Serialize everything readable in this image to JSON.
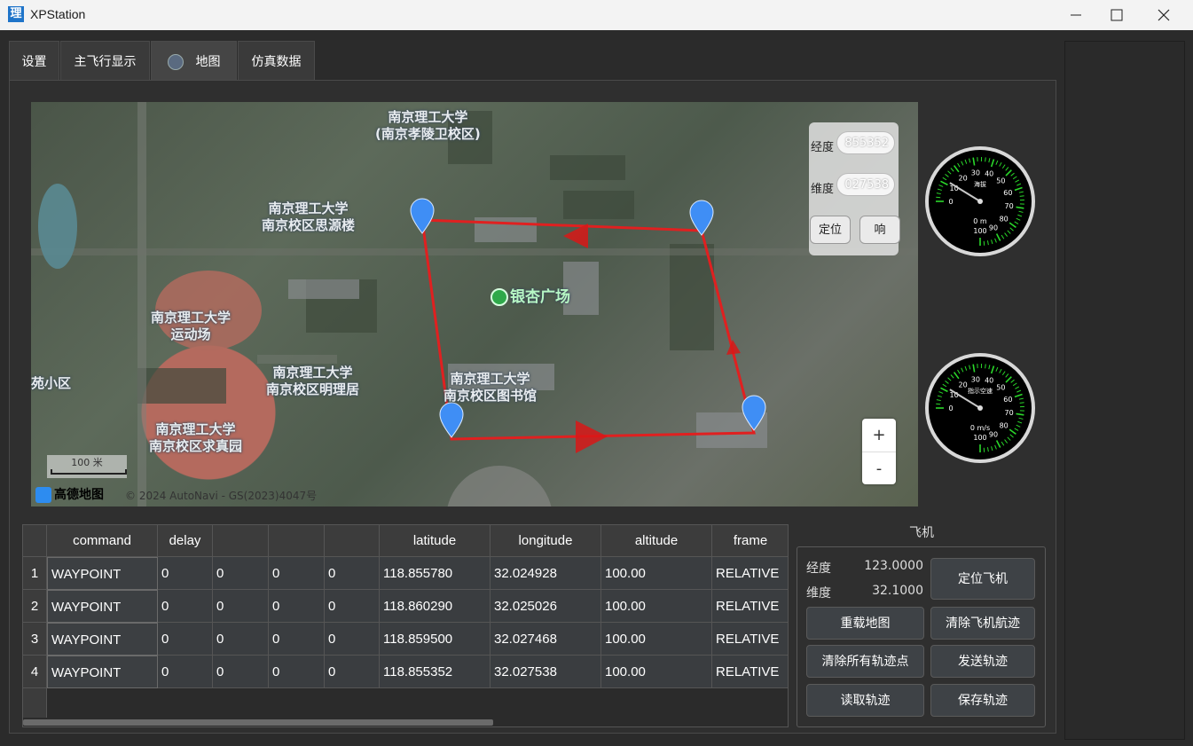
{
  "window": {
    "title": "XPStation",
    "icon_char": "理"
  },
  "tabs": [
    {
      "label": "设置"
    },
    {
      "label": "主飞行显示"
    },
    {
      "label": "地图"
    },
    {
      "label": "仿真数据"
    }
  ],
  "map": {
    "labels": [
      "南京理工大学\n(南京孝陵卫校区)",
      "南京理工大学\n南京校区思源楼",
      "南京理工大学\n运动场",
      "南京理工大学\n南京校区明理居",
      "南京理工大学\n南京校区图书馆",
      "南京理工大学\n南京校区求真园",
      "苑小区",
      "银杏广场"
    ],
    "overlay": {
      "lng_label": "经度",
      "lng_value": "855352",
      "lat_label": "维度",
      "lat_value": "027538",
      "locate_label": "定位",
      "other_label": "响"
    },
    "zoom_in": "+",
    "zoom_out": "-",
    "scale_label": "100 米",
    "logo_text": "高德地图",
    "copyright": "© 2024 AutoNavi - GS(2023)4047号"
  },
  "gauges": [
    {
      "title": "海拔",
      "unit": "0 m",
      "value": 0,
      "ticks": [
        "0",
        "10",
        "20",
        "30",
        "40",
        "50",
        "60",
        "70",
        "80",
        "90",
        "100"
      ]
    },
    {
      "title": "指示空速",
      "unit": "0 m/s",
      "value": 0,
      "ticks": [
        "0",
        "10",
        "20",
        "30",
        "40",
        "50",
        "60",
        "70",
        "80",
        "90",
        "100"
      ]
    }
  ],
  "table": {
    "headers": [
      "command",
      "delay",
      "",
      "",
      "",
      "latitude",
      "longitude",
      "altitude",
      "frame"
    ],
    "rows": [
      {
        "num": "1",
        "cells": [
          "WAYPOINT",
          "0",
          "0",
          "0",
          "0",
          "118.855780",
          "32.024928",
          "100.00",
          "RELATIVE"
        ]
      },
      {
        "num": "2",
        "cells": [
          "WAYPOINT",
          "0",
          "0",
          "0",
          "0",
          "118.860290",
          "32.025026",
          "100.00",
          "RELATIVE"
        ]
      },
      {
        "num": "3",
        "cells": [
          "WAYPOINT",
          "0",
          "0",
          "0",
          "0",
          "118.859500",
          "32.027468",
          "100.00",
          "RELATIVE"
        ]
      },
      {
        "num": "4",
        "cells": [
          "WAYPOINT",
          "0",
          "0",
          "0",
          "0",
          "118.855352",
          "32.027538",
          "100.00",
          "RELATIVE"
        ]
      }
    ]
  },
  "aircraft_panel": {
    "title": "飞机",
    "lng_label": "经度",
    "lng_value": "123.0000",
    "lat_label": "维度",
    "lat_value": "32.1000",
    "buttons": {
      "locate": "定位飞机",
      "reload_map": "重载地图",
      "clear_track": "清除飞机航迹",
      "clear_points": "清除所有轨迹点",
      "send_track": "发送轨迹",
      "read_track": "读取轨迹",
      "save_track": "保存轨迹"
    }
  },
  "colors": {
    "route": "#e02020",
    "marker": "#3f8ef5"
  }
}
